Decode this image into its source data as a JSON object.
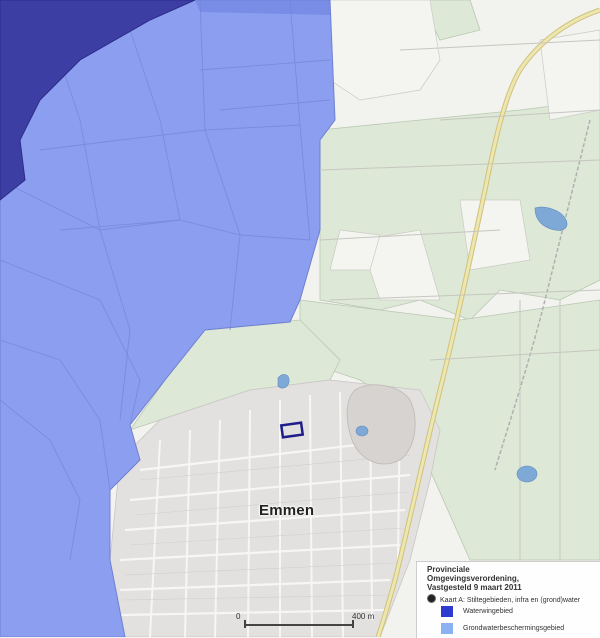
{
  "map": {
    "place_label": "Emmen",
    "scale": {
      "start_label": "0",
      "end_label": "400 m"
    },
    "colors": {
      "waterwingebied": "#3a3fc8",
      "grondwaterbeschermingsgebied": "#8c9ef0",
      "dark_zone": "#3a3aa0",
      "forest": "#dfe9d9",
      "field": "#f2f2ee",
      "urban": "#e2e0de",
      "road_main": "#e4dca0",
      "water": "#7ea8d6"
    }
  },
  "legend": {
    "title_lines": [
      "Provinciale",
      "Omgevingsverordening,",
      "Vastgesteld 9 maart 2011"
    ],
    "layer_label": "Kaart A: Stiltegebieden, infra en (grond)water",
    "items": [
      {
        "label": "Waterwingebied",
        "color": "#2f3ad0"
      },
      {
        "label": "Grondwaterbeschermingsgebied",
        "color": "#8ab1f2"
      }
    ]
  }
}
